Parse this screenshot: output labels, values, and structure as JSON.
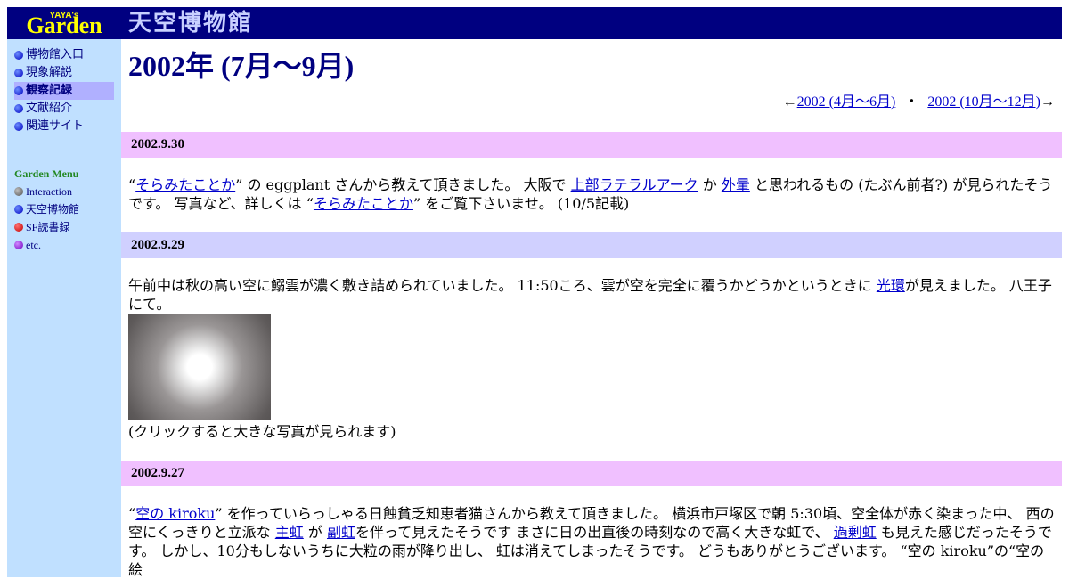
{
  "logo": {
    "small": "YAYA's",
    "big": "Garden"
  },
  "banner": {
    "title": "天空博物館"
  },
  "nav": {
    "items": [
      {
        "label": "博物館入口",
        "active": false
      },
      {
        "label": "現象解説",
        "active": false
      },
      {
        "label": "観察記録",
        "active": true
      },
      {
        "label": "文献紹介",
        "active": false
      },
      {
        "label": "関連サイト",
        "active": false
      }
    ]
  },
  "garden_menu": {
    "title": "Garden Menu",
    "items": [
      {
        "label": "Interaction",
        "icon": "gray-dot-icon"
      },
      {
        "label": "天空博物館",
        "icon": "blue-dot-icon"
      },
      {
        "label": "SF読書録",
        "icon": "red-dot-icon"
      },
      {
        "label": "etc.",
        "icon": "purple-dot-icon"
      }
    ]
  },
  "page": {
    "title": "2002年 (7月～9月)",
    "prev_arrow": "←",
    "prev_link": "2002 (4月～6月)",
    "separator": "・",
    "next_link": "2002 (10月～12月)",
    "next_arrow": "→"
  },
  "entries": [
    {
      "date": "2002.9.30",
      "parts": {
        "q1": "“",
        "link1": "そらみたことか",
        "t1": "” の eggplant さんから教えて頂きました。 大阪で ",
        "link2": "上部ラテラルアーク",
        "t2": " か ",
        "link3": "外暈",
        "t3": " と思われるもの (たぶん前者?) が見られたそうです。 写真など、詳しくは “",
        "link4": "そらみたことか",
        "t4": "” をご覧下さいませ。 (10/5記載)"
      }
    },
    {
      "date": "2002.9.29",
      "parts": {
        "t1": "午前中は秋の高い空に鰯雲が濃く敷き詰められていました。 11:50ころ、雲が空を完全に覆うかどうかというときに ",
        "link1": "光環",
        "t2": "が見えました。 八王子にて。",
        "caption": "(クリックすると大きな写真が見られます)"
      }
    },
    {
      "date": "2002.9.27",
      "parts": {
        "q1": "“",
        "link1": "空の kiroku",
        "t1": "” を作っていらっしゃる日蝕貧乏知恵者猫さんから教えて頂きました。 横浜市戸塚区で朝 5:30頃、空全体が赤く染まった中、 西の空にくっきりと立派な ",
        "link2": "主虹",
        "t2": " が ",
        "link3": "副虹",
        "t3": "を伴って見えたそうです まさに日の出直後の時刻なので高く大きな虹で、 ",
        "link4": "過剰虹",
        "t4": " も見えた感じだったそうです。 しかし、10分もしないうちに大粒の雨が降り出し、 虹は消えてしまったそうです。 どうもありがとうございます。 “空の kiroku”の“空の絵"
      }
    }
  ]
}
